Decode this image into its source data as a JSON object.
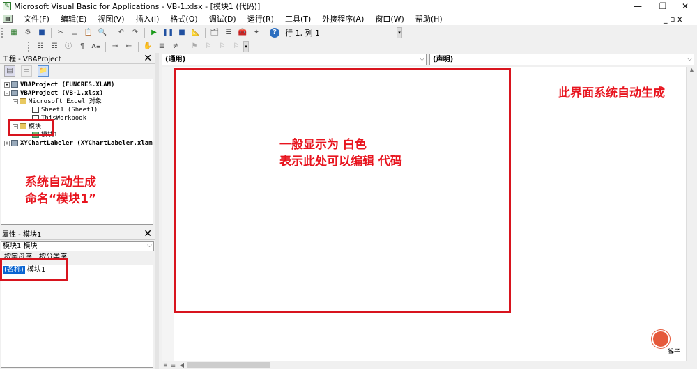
{
  "window": {
    "title": "Microsoft Visual Basic for Applications - VB-1.xlsx - [模块1 (代码)]",
    "minimize_glyph": "—",
    "restore_glyph": "❐",
    "close_glyph": "✕"
  },
  "menu": {
    "items": [
      "文件(F)",
      "编辑(E)",
      "视图(V)",
      "插入(I)",
      "格式(O)",
      "调试(D)",
      "运行(R)",
      "工具(T)",
      "外接程序(A)",
      "窗口(W)",
      "帮助(H)"
    ],
    "mdi_controls": "_ ▫ x"
  },
  "toolbar": {
    "cursor_position": "行 1, 列 1"
  },
  "project_panel": {
    "title": "工程 - VBAProject",
    "close": "✕",
    "tree": {
      "funcres": "VBAProject (FUNCRES.XLAM)",
      "vb1": "VBAProject (VB-1.xlsx)",
      "excel_objects": "Microsoft Excel 对象",
      "sheet1": "Sheet1 (Sheet1)",
      "thisworkbook": "ThisWorkbook",
      "modules_folder": "模块",
      "module1": "模块1",
      "xychart": "XYChartLabeler (XYChartLabeler.xlam)"
    }
  },
  "properties_panel": {
    "title": "属性 - 模块1",
    "close": "✕",
    "object_select": "模块1 模块",
    "object_bold": "模块1",
    "tabs": [
      "按字母序",
      "按分类序"
    ],
    "prop_name": "(名称)",
    "prop_value": "模块1"
  },
  "code_window": {
    "object_dropdown": "(通用)",
    "proc_dropdown": "(声明)"
  },
  "annotations": {
    "auto_generate_line1": "系统自动生成",
    "auto_generate_line2": "命名“模块1”",
    "white_line1": "一般显示为 白色",
    "white_line2": "表示此处可以编辑 代码",
    "interface_auto": "此界面系统自动生成",
    "watermark": "猴子"
  },
  "colors": {
    "annotation_red": "#e8141e",
    "selection_blue": "#0a64d2"
  }
}
